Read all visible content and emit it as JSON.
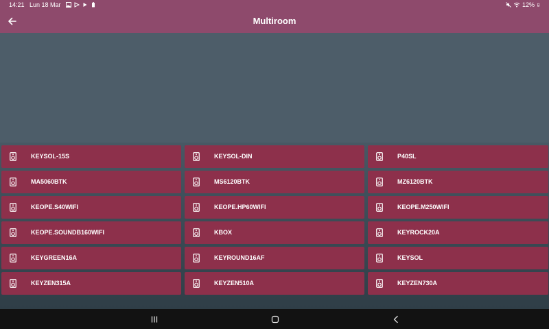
{
  "status_bar": {
    "time": "14:21",
    "date": "Lun 18 Mar",
    "left_icons": [
      "image-icon",
      "cast-icon",
      "play-store-icon",
      "battery-saver-icon"
    ],
    "right_icons": [
      "mute-icon",
      "wifi-icon"
    ],
    "battery": "12%"
  },
  "app_bar": {
    "title": "Multiroom",
    "back_icon": "arrow-left-icon"
  },
  "speakers": [
    {
      "label": "KEYSOL-15S"
    },
    {
      "label": "KEYSOL-DIN"
    },
    {
      "label": "P40SL"
    },
    {
      "label": "MA5060BTK"
    },
    {
      "label": "MS6120BTK"
    },
    {
      "label": "MZ6120BTK"
    },
    {
      "label": "KEOPE.S40WIFI"
    },
    {
      "label": "KEOPE.HP60WIFI"
    },
    {
      "label": "KEOPE.M250WIFI"
    },
    {
      "label": "KEOPE.SOUNDB160WIFI"
    },
    {
      "label": "KBOX"
    },
    {
      "label": "KEYROCK20A"
    },
    {
      "label": "KEYGREEN16A"
    },
    {
      "label": "KEYROUND16AF"
    },
    {
      "label": "KEYSOL"
    },
    {
      "label": "KEYZEN315A"
    },
    {
      "label": "KEYZEN510A"
    },
    {
      "label": "KEYZEN730A"
    }
  ],
  "speaker_icon": "speaker-icon",
  "nav_bar": {
    "buttons": [
      "recents-icon",
      "home-icon",
      "back-icon"
    ]
  },
  "colors": {
    "app_bar": "#8e4a6c",
    "tile": "#8d304b",
    "background": "#4a5a66",
    "nav_bar": "#121212"
  }
}
